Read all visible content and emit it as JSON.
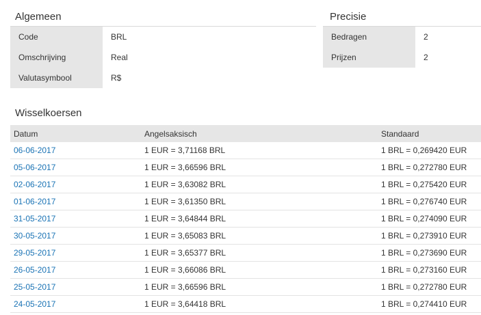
{
  "general": {
    "title": "Algemeen",
    "rows": [
      {
        "label": "Code",
        "value": "BRL"
      },
      {
        "label": "Omschrijving",
        "value": "Real"
      },
      {
        "label": "Valutasymbool",
        "value": "R$"
      }
    ]
  },
  "precision": {
    "title": "Precisie",
    "rows": [
      {
        "label": "Bedragen",
        "value": "2"
      },
      {
        "label": "Prijzen",
        "value": "2"
      }
    ]
  },
  "rates": {
    "title": "Wisselkoersen",
    "headers": {
      "date": "Datum",
      "requested": "Angelsaksisch",
      "standard": "Standaard"
    },
    "rows": [
      {
        "date": "06-06-2017",
        "requested": "1 EUR = 3,71168 BRL",
        "standard": "1 BRL = 0,269420 EUR"
      },
      {
        "date": "05-06-2017",
        "requested": "1 EUR = 3,66596 BRL",
        "standard": "1 BRL = 0,272780 EUR"
      },
      {
        "date": "02-06-2017",
        "requested": "1 EUR = 3,63082 BRL",
        "standard": "1 BRL = 0,275420 EUR"
      },
      {
        "date": "01-06-2017",
        "requested": "1 EUR = 3,61350 BRL",
        "standard": "1 BRL = 0,276740 EUR"
      },
      {
        "date": "31-05-2017",
        "requested": "1 EUR = 3,64844 BRL",
        "standard": "1 BRL = 0,274090 EUR"
      },
      {
        "date": "30-05-2017",
        "requested": "1 EUR = 3,65083 BRL",
        "standard": "1 BRL = 0,273910 EUR"
      },
      {
        "date": "29-05-2017",
        "requested": "1 EUR = 3,65377 BRL",
        "standard": "1 BRL = 0,273690 EUR"
      },
      {
        "date": "26-05-2017",
        "requested": "1 EUR = 3,66086 BRL",
        "standard": "1 BRL = 0,273160 EUR"
      },
      {
        "date": "25-05-2017",
        "requested": "1 EUR = 3,66596 BRL",
        "standard": "1 BRL = 0,272780 EUR"
      },
      {
        "date": "24-05-2017",
        "requested": "1 EUR = 3,64418 BRL",
        "standard": "1 BRL = 0,274410 EUR"
      }
    ]
  },
  "colors": {
    "link": "#1a73b5",
    "label_bg": "#e6e6e6"
  }
}
